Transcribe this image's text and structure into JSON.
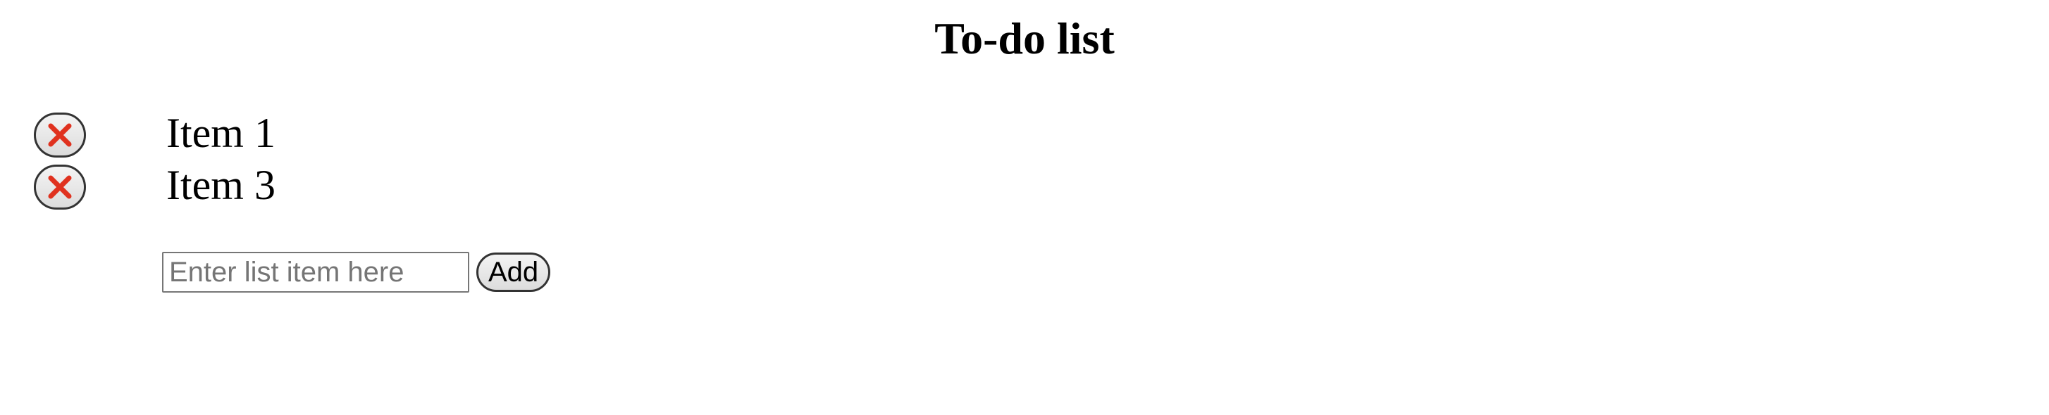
{
  "page": {
    "title": "To-do list"
  },
  "list": {
    "items": [
      {
        "label": "Item 1",
        "delete_icon": "close-x-icon"
      },
      {
        "label": "Item 3",
        "delete_icon": "close-x-icon"
      }
    ]
  },
  "form": {
    "input_value": "",
    "input_placeholder": "Enter list item here",
    "add_label": "Add"
  },
  "colors": {
    "delete_icon": "#e0321f",
    "button_border": "#333333",
    "background": "#ffffff"
  }
}
